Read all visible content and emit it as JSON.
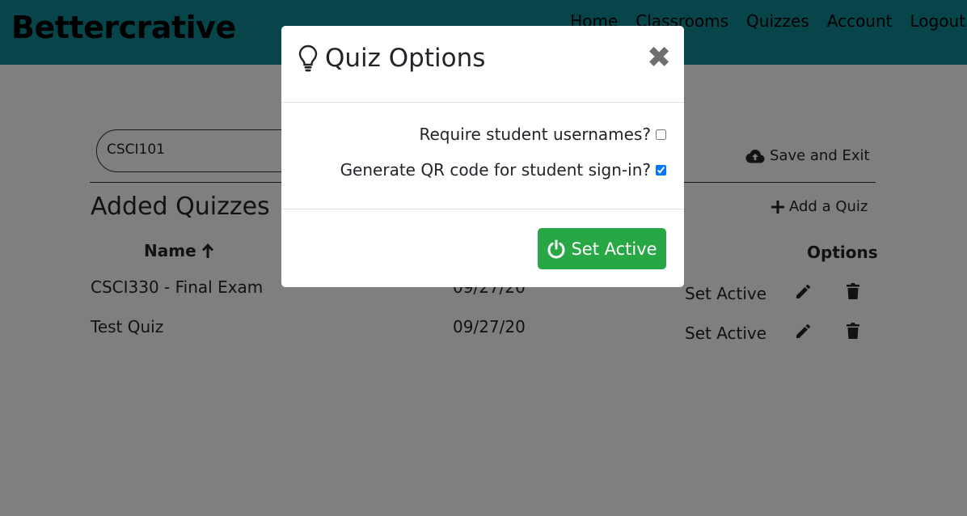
{
  "app": {
    "brand": "Bettercrative",
    "nav": [
      "Home",
      "Classrooms",
      "Quizzes",
      "Account",
      "Logout"
    ]
  },
  "classroom": {
    "name": "CSCI101"
  },
  "toolbar": {
    "save_exit": "Save and Exit",
    "add_quiz": "Add a Quiz"
  },
  "section": {
    "title": "Added Quizzes"
  },
  "table": {
    "headers": {
      "name": "Name",
      "options": "Options"
    },
    "rows": [
      {
        "name": "CSCI330 - Final Exam",
        "date": "09/27/20",
        "action": "Set Active"
      },
      {
        "name": "Test Quiz",
        "date": "09/27/20",
        "action": "Set Active"
      }
    ]
  },
  "modal": {
    "title": "Quiz Options",
    "options": [
      {
        "label": "Require student usernames?",
        "checked": false
      },
      {
        "label": "Generate QR code for student sign-in?",
        "checked": true
      }
    ],
    "primary_button": "Set Active",
    "close_symbol": "✖"
  },
  "colors": {
    "navbar": "#0e8a96",
    "success": "#28a745",
    "overlay": "rgba(0,0,0,0.5)"
  }
}
